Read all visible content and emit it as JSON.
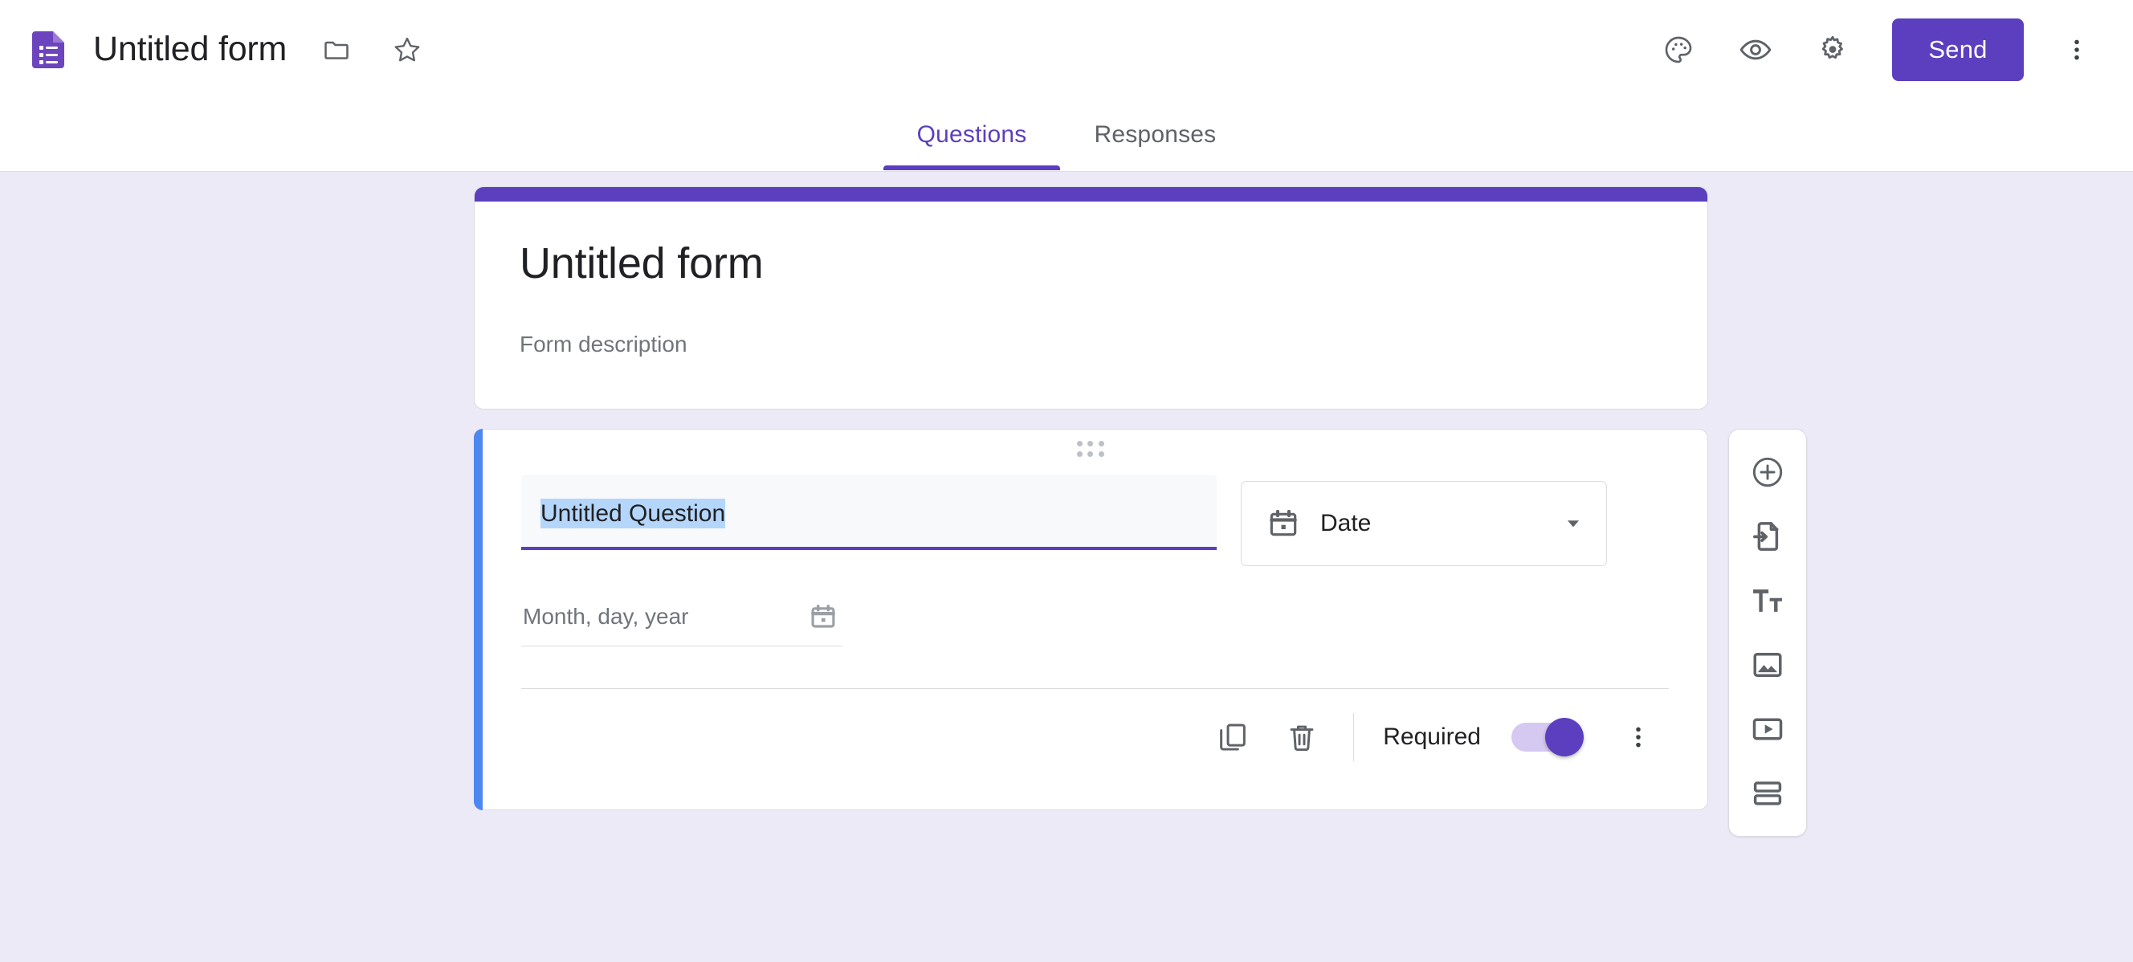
{
  "app": {
    "product_icon": "google-forms-icon",
    "document_title": "Untitled form"
  },
  "appbar": {
    "move_to_folder_icon": "folder-icon",
    "star_icon": "star-icon",
    "theme_icon": "palette-icon",
    "preview_icon": "eye-icon",
    "settings_icon": "gear-icon",
    "send_label": "Send",
    "more_icon": "more-vertical-icon"
  },
  "tabs": [
    {
      "label": "Questions",
      "active": true
    },
    {
      "label": "Responses",
      "active": false
    }
  ],
  "form_header": {
    "title": "Untitled form",
    "description": "Form description",
    "stripe_color": "#5B3FBF"
  },
  "question": {
    "drag_handle_icon": "drag-handle-icon",
    "title_text": "Untitled Question",
    "title_selected": true,
    "selection_color": "#B5D6FB",
    "accent_bar_color": "#4D87F0",
    "type": {
      "icon": "calendar-icon",
      "label": "Date",
      "chevron_icon": "chevron-down-icon"
    },
    "answer_preview": {
      "placeholder": "Month, day, year",
      "icon": "calendar-icon"
    },
    "footer": {
      "duplicate_icon": "copy-icon",
      "delete_icon": "trash-icon",
      "required_label": "Required",
      "required_on": true,
      "toggle_on_color": "#5B3FBF",
      "more_icon": "more-vertical-icon"
    }
  },
  "side_toolbar": [
    {
      "icon": "add-question-icon",
      "name": "add-question"
    },
    {
      "icon": "import-questions-icon",
      "name": "import-questions"
    },
    {
      "icon": "add-title-description-icon",
      "name": "add-title-and-description"
    },
    {
      "icon": "add-image-icon",
      "name": "add-image"
    },
    {
      "icon": "add-video-icon",
      "name": "add-video"
    },
    {
      "icon": "add-section-icon",
      "name": "add-section"
    }
  ],
  "theme": {
    "background": "#ECEAF7",
    "primary": "#5B3FBF",
    "card_background": "#FFFFFF"
  }
}
